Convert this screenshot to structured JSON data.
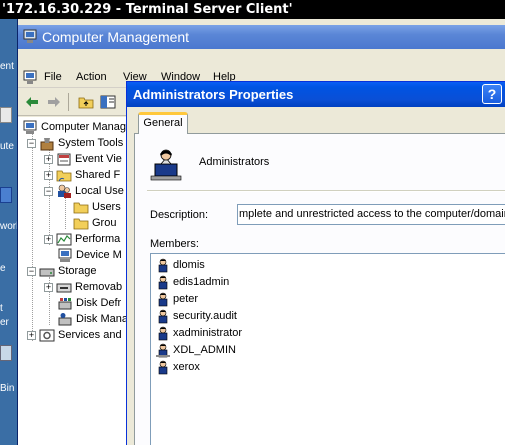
{
  "terminal": {
    "title": "'172.16.30.229 - Terminal Server Client'"
  },
  "desktop": {
    "labels": [
      "ent",
      "ute",
      "work",
      "e",
      "t",
      "er",
      "Bin"
    ]
  },
  "cm": {
    "title": "Computer Management",
    "menu": [
      "File",
      "Action",
      "View",
      "Window",
      "Help"
    ],
    "toolbar": [
      "back-icon",
      "forward-icon",
      "up-folder-icon",
      "show-hide-tree-icon"
    ],
    "tree": [
      {
        "label": "Computer Manag",
        "expander": ""
      },
      {
        "label": "System Tools",
        "expander": "−"
      },
      {
        "label": "Event Vie",
        "expander": "+"
      },
      {
        "label": "Shared F",
        "expander": "+"
      },
      {
        "label": "Local Use",
        "expander": "−"
      },
      {
        "label": "Users",
        "expander": ""
      },
      {
        "label": "Grou",
        "expander": ""
      },
      {
        "label": "Performa",
        "expander": "+"
      },
      {
        "label": "Device M",
        "expander": ""
      },
      {
        "label": "Storage",
        "expander": "−"
      },
      {
        "label": "Removab",
        "expander": "+"
      },
      {
        "label": "Disk Defr",
        "expander": ""
      },
      {
        "label": "Disk Mana",
        "expander": ""
      },
      {
        "label": "Services and",
        "expander": "+"
      }
    ]
  },
  "dialog": {
    "title": "Administrators Properties",
    "help": "?",
    "tab": "General",
    "group_name": "Administrators",
    "description_label": "Description:",
    "description_value": "mplete and unrestricted access to the computer/domain",
    "members_label": "Members:",
    "members": [
      "dlomis",
      "edis1admin",
      "peter",
      "security.audit",
      "xadministrator",
      "XDL_ADMIN",
      "xerox"
    ]
  }
}
